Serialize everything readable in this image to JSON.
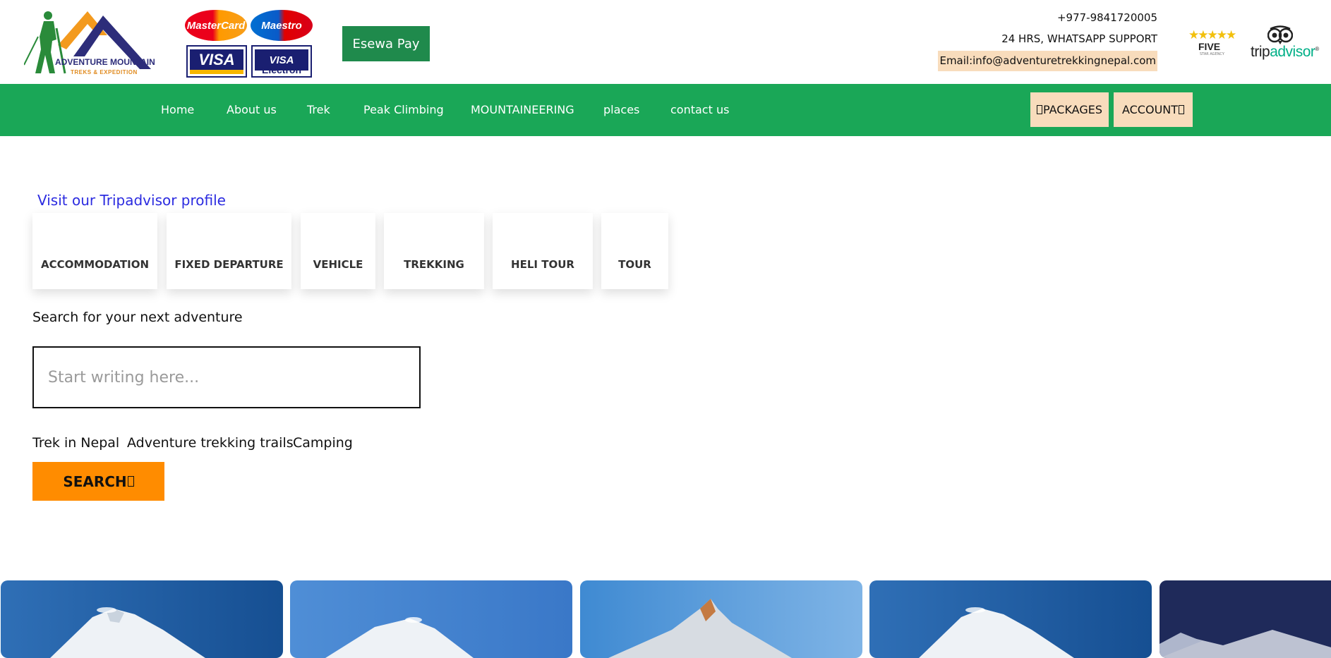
{
  "brand": {
    "name": "ADVENTURE MOUNTAIN",
    "tagline": "TREKS & EXPEDITION"
  },
  "payment_cards": {
    "mastercard": "MasterCard",
    "maestro": "Maestro",
    "visa": "VISA",
    "visa_electron_1": "VISA",
    "visa_electron_2": "Electron"
  },
  "esewa_label": "Esewa Pay",
  "contact": {
    "phone": "+977-9841720005",
    "support": "24 HRS, WHATSAPP SUPPORT",
    "email": "Email:info@adventuretrekkingnepal.com"
  },
  "badges": {
    "five_star_stars": "★★★★★",
    "five_star_word": "FIVE",
    "five_star_sub": "STAR AGENCY",
    "tripadvisor_trip": "trip",
    "tripadvisor_advisor": "advisor",
    "tripadvisor_reg": "®"
  },
  "nav": {
    "items": [
      {
        "label": "Home"
      },
      {
        "label": "About us"
      },
      {
        "label": "Trek"
      },
      {
        "label": "Peak Climbing"
      },
      {
        "label": "MOUNTAINEERING"
      },
      {
        "label": "places"
      },
      {
        "label": "contact us"
      }
    ],
    "packages": "PACKAGES",
    "account": "ACCOUNT"
  },
  "tripadvisor_profile": "Visit our Tripadvisor profile",
  "categories": [
    {
      "label": "ACCOMMODATION"
    },
    {
      "label": "FIXED DEPARTURE"
    },
    {
      "label": "VEHICLE"
    },
    {
      "label": "TREKKING"
    },
    {
      "label": "HELI TOUR"
    },
    {
      "label": "TOUR"
    }
  ],
  "search": {
    "label": "Search for your next adventure",
    "placeholder": "Start writing here...",
    "tags": [
      {
        "label": "Trek in Nepal"
      },
      {
        "label": "Adventure trekking trails"
      },
      {
        "label": "Camping"
      }
    ],
    "button": "SEARCH"
  },
  "colors": {
    "nav_green": "#1aa757",
    "esewa_green": "#1f8a4c",
    "pill_peach": "#f8dcbc",
    "search_orange": "#ff8c00",
    "link_blue": "#2b2be0"
  }
}
